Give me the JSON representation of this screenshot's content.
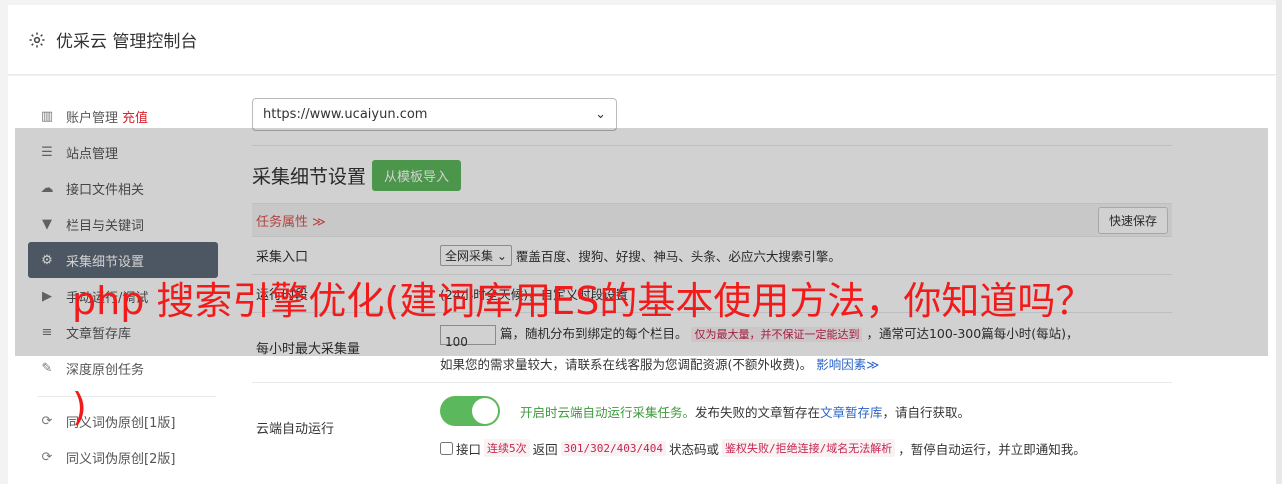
{
  "header": {
    "title": "优采云 管理控制台"
  },
  "sidebar": {
    "items": [
      {
        "icon": "bar-chart-icon",
        "glyph": "▥",
        "label": "账户管理",
        "tag": "充值"
      },
      {
        "icon": "server-icon",
        "glyph": "☰",
        "label": "站点管理"
      },
      {
        "icon": "cloud-upload-icon",
        "glyph": "☁",
        "label": "接口文件相关"
      },
      {
        "icon": "filter-icon",
        "glyph": "▼",
        "label": "栏目与关键词"
      },
      {
        "icon": "gears-icon",
        "glyph": "⚙",
        "label": "采集细节设置"
      },
      {
        "icon": "play-circle-icon",
        "glyph": "▶",
        "label": "手动运行/调试"
      },
      {
        "icon": "database-icon",
        "glyph": "≡",
        "label": "文章暂存库"
      },
      {
        "icon": "edit-icon",
        "glyph": "✎",
        "label": "深度原创任务"
      }
    ],
    "items2": [
      {
        "icon": "refresh-icon",
        "glyph": "⟳",
        "label": "同义词伪原创[1版]"
      },
      {
        "icon": "refresh-icon",
        "glyph": "⟳",
        "label": "同义词伪原创[2版]"
      }
    ]
  },
  "main": {
    "site_select": "https://www.ucaiyun.com",
    "section_title": "采集细节设置",
    "import_button": "从模板导入",
    "task_attr": "任务属性 ≫",
    "quick_save": "快速保存",
    "rows": {
      "entry_label": "采集入口",
      "entry_select": "全网采集",
      "entry_desc": "覆盖百度、搜狗、好搜、神马、头条、必应六大搜索引擎。",
      "runtime_label": "运行时段",
      "runtime_desc": "(24小时全天候)，自定义时段设置",
      "hourly_label": "每小时最大采集量",
      "hourly_value": "100",
      "hourly_text1": "篇，随机分布到绑定的每个栏目。",
      "hourly_warn": "仅为最大量，并不保证一定能达到",
      "hourly_text2": "，通常可达100-300篇每小时(每站)，",
      "hourly_text3": "如果您的需求量较大，请联系在线客服为您调配资源(不额外收费)。",
      "hourly_link": "影响因素≫",
      "cloud_label": "云端自动运行",
      "cloud_text1": "开启时云端自动运行采集任务。",
      "cloud_text2": "发布失败的文章暂存在",
      "cloud_link": "文章暂存库",
      "cloud_text3": "，请自行获取。",
      "api_text1": "接口",
      "api_code1": "连续5次",
      "api_text2": "返回",
      "api_code2": "301/302/403/404",
      "api_text3": "状态码或",
      "api_code3": "鉴权失败/拒绝连接/域名无法解析",
      "api_text4": "，暂停自动运行，并立即通知我。"
    }
  },
  "overlay_title": "php 搜索引擎优化(建词库用ES的基本使用方法，你知道吗？",
  "overlay_paren": ")"
}
